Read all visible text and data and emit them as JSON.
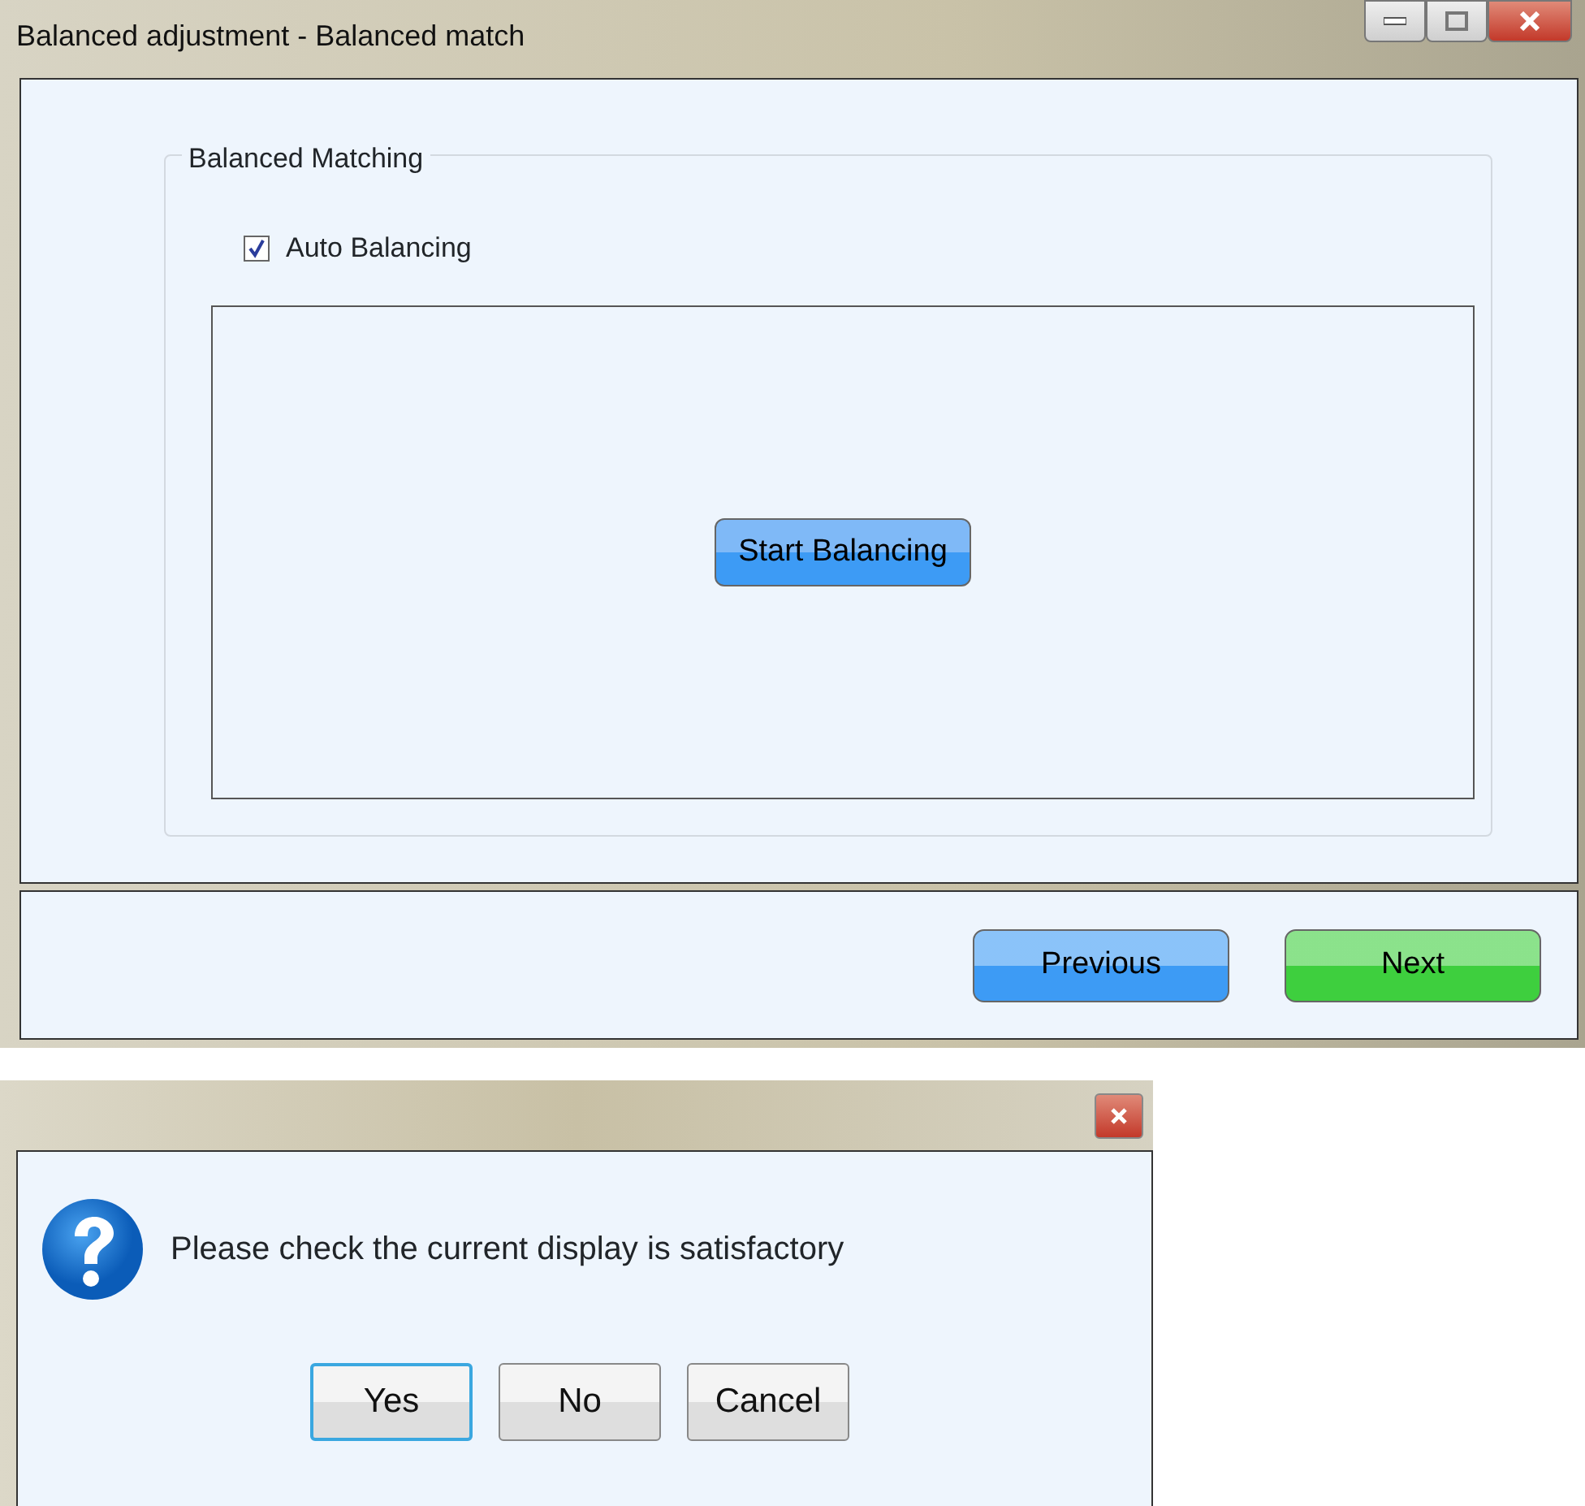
{
  "main_window": {
    "title": "Balanced adjustment - Balanced match",
    "group": {
      "title": "Balanced Matching",
      "auto_balancing": {
        "label": "Auto Balancing",
        "checked": true
      },
      "start_button": "Start Balancing"
    },
    "nav_buttons": [
      {
        "label": "Previous",
        "color": "#3d9bf5"
      },
      {
        "label": "Next",
        "color": "#3ecf3e"
      }
    ]
  },
  "dialog": {
    "message": "Please check the current display is satisfactory",
    "buttons": [
      {
        "label": "Yes",
        "focused": true
      },
      {
        "label": "No",
        "focused": false
      },
      {
        "label": "Cancel",
        "focused": false
      }
    ]
  }
}
